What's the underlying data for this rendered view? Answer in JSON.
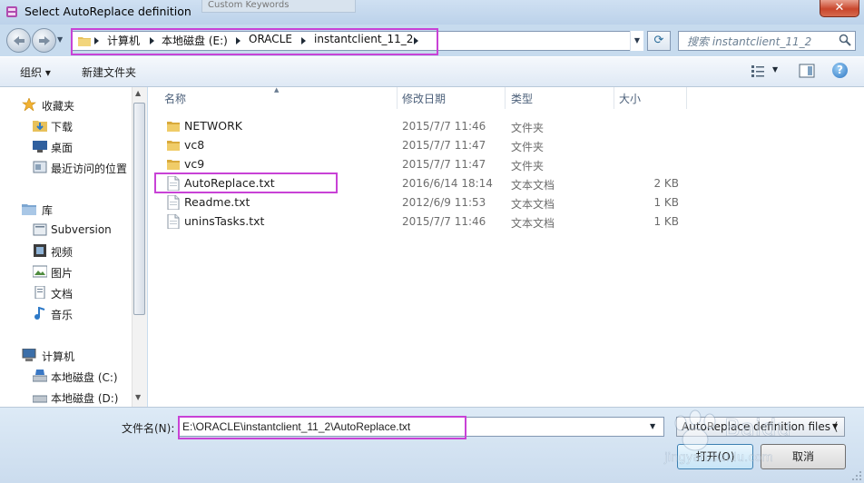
{
  "window": {
    "title": "Select AutoReplace definition",
    "ghost_title": "Custom Keywords",
    "close_label": "✕"
  },
  "address": {
    "crumbs": [
      "计算机",
      "本地磁盘 (E:)",
      "ORACLE",
      "instantclient_11_2"
    ],
    "search_placeholder": "搜索 instantclient_11_2"
  },
  "toolbar": {
    "organize": "组织 ▾",
    "new_folder": "新建文件夹"
  },
  "nav": {
    "favorites_header": "收藏夹",
    "favorites": [
      "下载",
      "桌面",
      "最近访问的位置"
    ],
    "libraries_header": "库",
    "libraries": [
      "Subversion",
      "视频",
      "图片",
      "文档",
      "音乐"
    ],
    "computer_header": "计算机",
    "drives": [
      "本地磁盘 (C:)",
      "本地磁盘 (D:)"
    ]
  },
  "columns": {
    "name": "名称",
    "modified": "修改日期",
    "type": "类型",
    "size": "大小"
  },
  "files": [
    {
      "name": "NETWORK",
      "modified": "2015/7/7 11:46",
      "type": "文件夹",
      "size": "",
      "icon": "folder-icon"
    },
    {
      "name": "vc8",
      "modified": "2015/7/7 11:47",
      "type": "文件夹",
      "size": "",
      "icon": "folder-icon"
    },
    {
      "name": "vc9",
      "modified": "2015/7/7 11:47",
      "type": "文件夹",
      "size": "",
      "icon": "folder-icon"
    },
    {
      "name": "AutoReplace.txt",
      "modified": "2016/6/14 18:14",
      "type": "文本文档",
      "size": "2 KB",
      "icon": "text-file-icon"
    },
    {
      "name": "Readme.txt",
      "modified": "2012/6/9 11:53",
      "type": "文本文档",
      "size": "1 KB",
      "icon": "text-file-icon"
    },
    {
      "name": "uninsTasks.txt",
      "modified": "2015/7/7 11:46",
      "type": "文本文档",
      "size": "1 KB",
      "icon": "text-file-icon"
    }
  ],
  "footer": {
    "filename_label": "文件名(N):",
    "filename_value": "E:\\ORACLE\\instantclient_11_2\\AutoReplace.txt",
    "filetype_value": "AutoReplace definition files (",
    "open_label": "打开(O)",
    "cancel_label": "取消"
  },
  "colors": {
    "highlight": "#c842d6",
    "titlebar": "#c9dcee",
    "folder": "#e8c15a"
  }
}
